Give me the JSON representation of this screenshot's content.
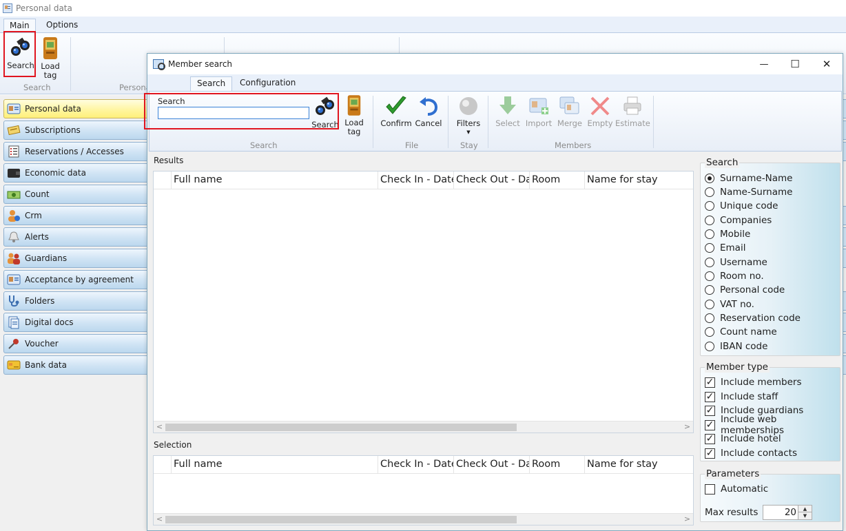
{
  "app": {
    "title": "Personal data",
    "tabs": [
      "Main",
      "Options"
    ],
    "ribbon": {
      "search_label": "Search",
      "load_tag_line1": "Load",
      "load_tag_line2": "tag",
      "group_search": "Search",
      "group_personal": "Persona"
    },
    "sidebar": [
      {
        "label": "Personal data",
        "icon": "id-card-icon"
      },
      {
        "label": "Subscriptions",
        "icon": "ticket-icon"
      },
      {
        "label": "Reservations / Accesses",
        "icon": "list-icon"
      },
      {
        "label": "Economic data",
        "icon": "wallet-icon"
      },
      {
        "label": "Count",
        "icon": "money-icon"
      },
      {
        "label": "Crm",
        "icon": "person-info-icon"
      },
      {
        "label": "Alerts",
        "icon": "bell-icon"
      },
      {
        "label": "Guardians",
        "icon": "people-icon"
      },
      {
        "label": "Acceptance by agreement",
        "icon": "id-card-icon"
      },
      {
        "label": "Folders",
        "icon": "stethoscope-icon"
      },
      {
        "label": "Digital docs",
        "icon": "document-icon"
      },
      {
        "label": "Voucher",
        "icon": "pin-icon"
      },
      {
        "label": "Bank data",
        "icon": "bank-card-icon"
      }
    ]
  },
  "dialog": {
    "title": "Member search",
    "controls": {
      "minimize": "—",
      "maximize": "☐",
      "close": "✕"
    },
    "tabs": [
      "Search",
      "Configuration"
    ],
    "ribbon": {
      "search_caption": "Search",
      "search_value": "",
      "buttons": {
        "search": "Search",
        "load_tag_line1": "Load",
        "load_tag_line2": "tag",
        "confirm": "Confirm",
        "cancel": "Cancel",
        "filters": "Filters",
        "select": "Select",
        "import": "Import",
        "merge": "Merge",
        "empty": "Empty",
        "estimate": "Estimate"
      },
      "groups": {
        "search": "Search",
        "file": "File",
        "stay": "Stay",
        "members": "Members"
      }
    },
    "results": {
      "label": "Results",
      "columns": [
        "Full name",
        "Check In - Date",
        "Check Out - Date",
        "Room",
        "Name for stay"
      ]
    },
    "selection": {
      "label": "Selection",
      "columns": [
        "Full name",
        "Check In - Date",
        "Check Out - Date",
        "Room",
        "Name for stay"
      ]
    },
    "search_panel": {
      "title": "Search",
      "options": [
        "Surname-Name",
        "Name-Surname",
        "Unique code",
        "Companies",
        "Mobile",
        "Email",
        "Username",
        "Room no.",
        "Personal code",
        "VAT no.",
        "Reservation code",
        "Count name",
        "IBAN code"
      ],
      "selected_index": 0
    },
    "member_type": {
      "title": "Member type",
      "options": [
        "Include members",
        "Include staff",
        "Include guardians",
        "Include web memberships",
        "Include hotel",
        "Include contacts"
      ]
    },
    "parameters": {
      "title": "Parameters",
      "automatic_label": "Automatic",
      "max_results_label": "Max results",
      "max_results_value": "20"
    }
  }
}
